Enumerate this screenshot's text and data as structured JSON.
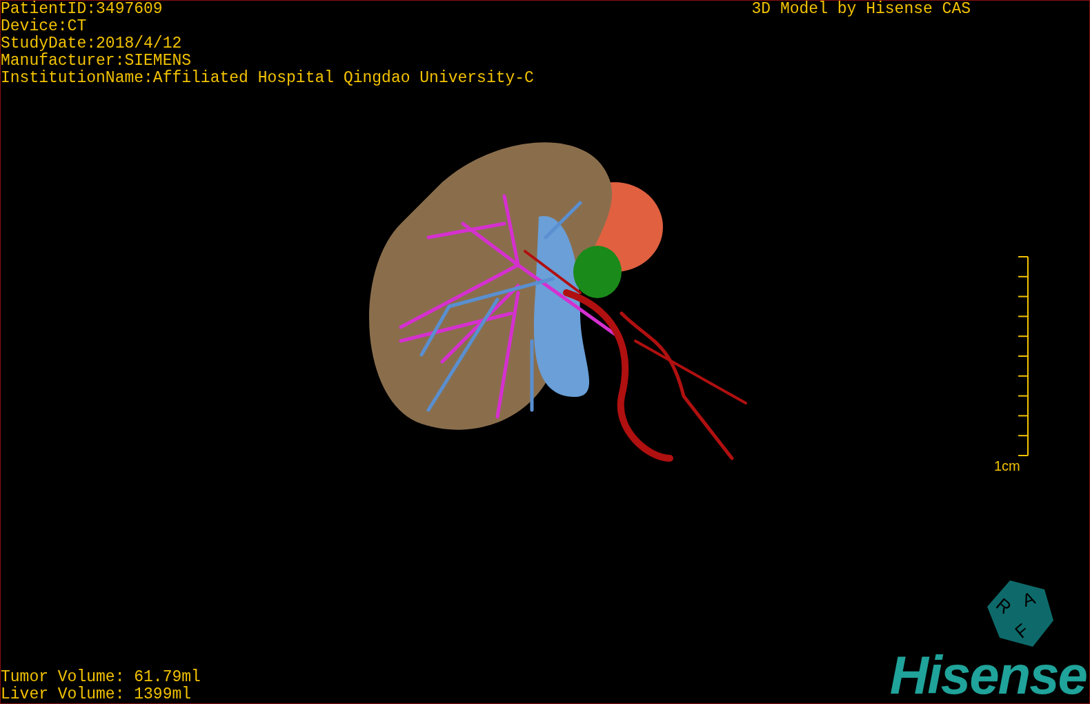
{
  "info_lines": [
    "PatientID:3497609",
    "Device:CT",
    "StudyDate:2018/4/12",
    "Manufacturer:SIEMENS",
    "InstitutionName:Affiliated Hospital Qingdao University-C"
  ],
  "title": "3D Model by Hisense CAS",
  "scale_bar": {
    "label": "1cm"
  },
  "volumes": [
    "Tumor Volume: 61.79ml",
    "Liver Volume: 1399ml"
  ],
  "orientation_cube": {
    "labels": [
      "R",
      "A",
      "F"
    ]
  },
  "logo": "Hisense"
}
